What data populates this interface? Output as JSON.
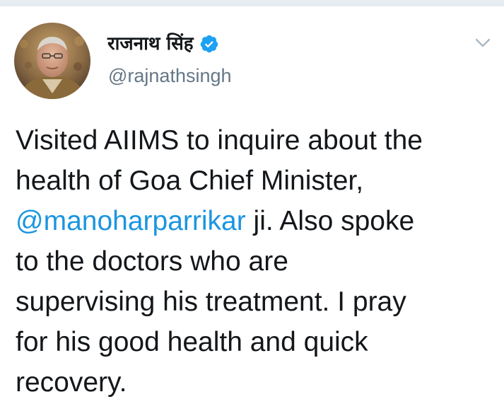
{
  "colors": {
    "text": "#14171a",
    "secondary": "#657786",
    "link": "#1b95e0",
    "verified_badge": "#1da1f2",
    "divider": "#e6ecf0"
  },
  "author": {
    "display_name": "राजनाथ सिंह",
    "handle": "@rajnathsingh",
    "verified": true,
    "avatar_icon": "profile-photo",
    "verified_icon": "verified-badge-icon"
  },
  "menu": {
    "icon": "chevron-down-icon"
  },
  "tweet": {
    "line1": "Visited AIIMS to inquire about the",
    "line2": "health of Goa Chief Minister,",
    "line3_mention": "@manoharparrikar",
    "line3_rest": " ji. Also spoke",
    "line4": "to the doctors who are",
    "line5": "supervising his treatment. I pray",
    "line6": "for his good health and quick",
    "line7": "recovery."
  }
}
